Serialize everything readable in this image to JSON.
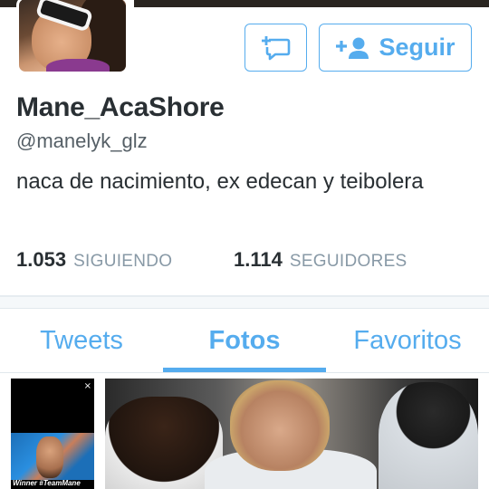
{
  "profile": {
    "display_name": "Mane_AcaShore",
    "handle": "@manelyk_glz",
    "bio": "naca de nacimiento, ex edecan y teibolera"
  },
  "actions": {
    "dm_icon": "add-message-icon",
    "follow_icon": "add-user-icon",
    "follow_label": "Seguir"
  },
  "stats": {
    "following_count": "1.053",
    "following_label": "SIGUIENDO",
    "followers_count": "1.114",
    "followers_label": "SEGUIDORES"
  },
  "tabs": [
    {
      "label": "Tweets",
      "active": false
    },
    {
      "label": "Fotos",
      "active": true
    },
    {
      "label": "Favoritos",
      "active": false
    }
  ],
  "media": {
    "thumb_small_close": "×",
    "thumb_small_caption": "Winner #TeamMane"
  },
  "colors": {
    "accent": "#55acee",
    "text": "#292f33",
    "muted": "#8899a6"
  }
}
